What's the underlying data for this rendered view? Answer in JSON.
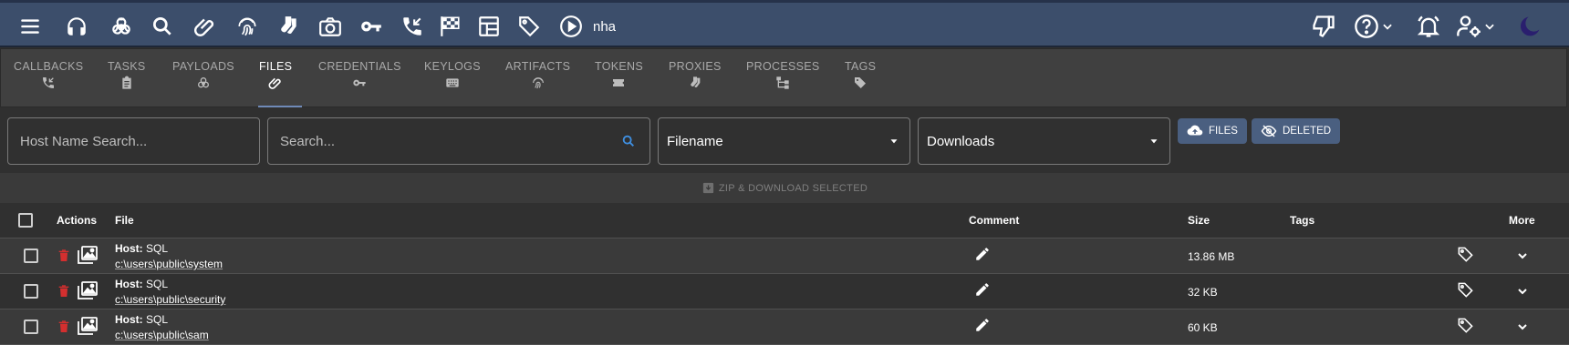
{
  "topbar": {
    "callback_label": "nha",
    "icons": [
      "menu-icon",
      "headphones-icon",
      "biohazard-icon",
      "search-icon",
      "paperclip-icon",
      "fingerprint-icon",
      "socks-icon",
      "camera-icon",
      "key-icon",
      "phone-callback-icon",
      "checkered-flag-icon",
      "table-icon",
      "tag-icon",
      "play-circle-icon"
    ],
    "right_icons": [
      "thumb-down-icon",
      "help-icon",
      "alarm-bell-icon",
      "user-settings-icon",
      "moon-icon"
    ]
  },
  "tabs": [
    {
      "label": "CALLBACKS",
      "icon": "phone-callback-icon"
    },
    {
      "label": "TASKS",
      "icon": "clipboard-icon"
    },
    {
      "label": "PAYLOADS",
      "icon": "biohazard-icon"
    },
    {
      "label": "FILES",
      "icon": "paperclip-icon",
      "active": true
    },
    {
      "label": "CREDENTIALS",
      "icon": "key-icon"
    },
    {
      "label": "KEYLOGS",
      "icon": "keyboard-icon"
    },
    {
      "label": "ARTIFACTS",
      "icon": "fingerprint-icon"
    },
    {
      "label": "TOKENS",
      "icon": "ticket-icon"
    },
    {
      "label": "PROXIES",
      "icon": "socks-icon"
    },
    {
      "label": "PROCESSES",
      "icon": "sitemap-icon"
    },
    {
      "label": "TAGS",
      "icon": "tag-icon"
    }
  ],
  "filters": {
    "host_placeholder": "Host Name Search...",
    "search_placeholder": "Search...",
    "field_select": "Filename",
    "type_select": "Downloads",
    "files_button": "FILES",
    "deleted_button": "DELETED"
  },
  "zip_label": "ZIP & DOWNLOAD SELECTED",
  "table": {
    "headers": {
      "actions": "Actions",
      "file": "File",
      "comment": "Comment",
      "size": "Size",
      "tags": "Tags",
      "more": "More"
    },
    "host_prefix": "Host:",
    "rows": [
      {
        "host": "SQL",
        "path": "c:\\users\\public\\system",
        "size": "13.86 MB"
      },
      {
        "host": "SQL",
        "path": "c:\\users\\public\\security",
        "size": "32 KB"
      },
      {
        "host": "SQL",
        "path": "c:\\users\\public\\sam",
        "size": "60 KB"
      }
    ]
  },
  "colors": {
    "topbar": "#3c4e6b",
    "accent": "#4a5f80",
    "trash": "#d32f2f",
    "search_icon": "#3f8fe0",
    "moon": "#2a1f6e"
  }
}
